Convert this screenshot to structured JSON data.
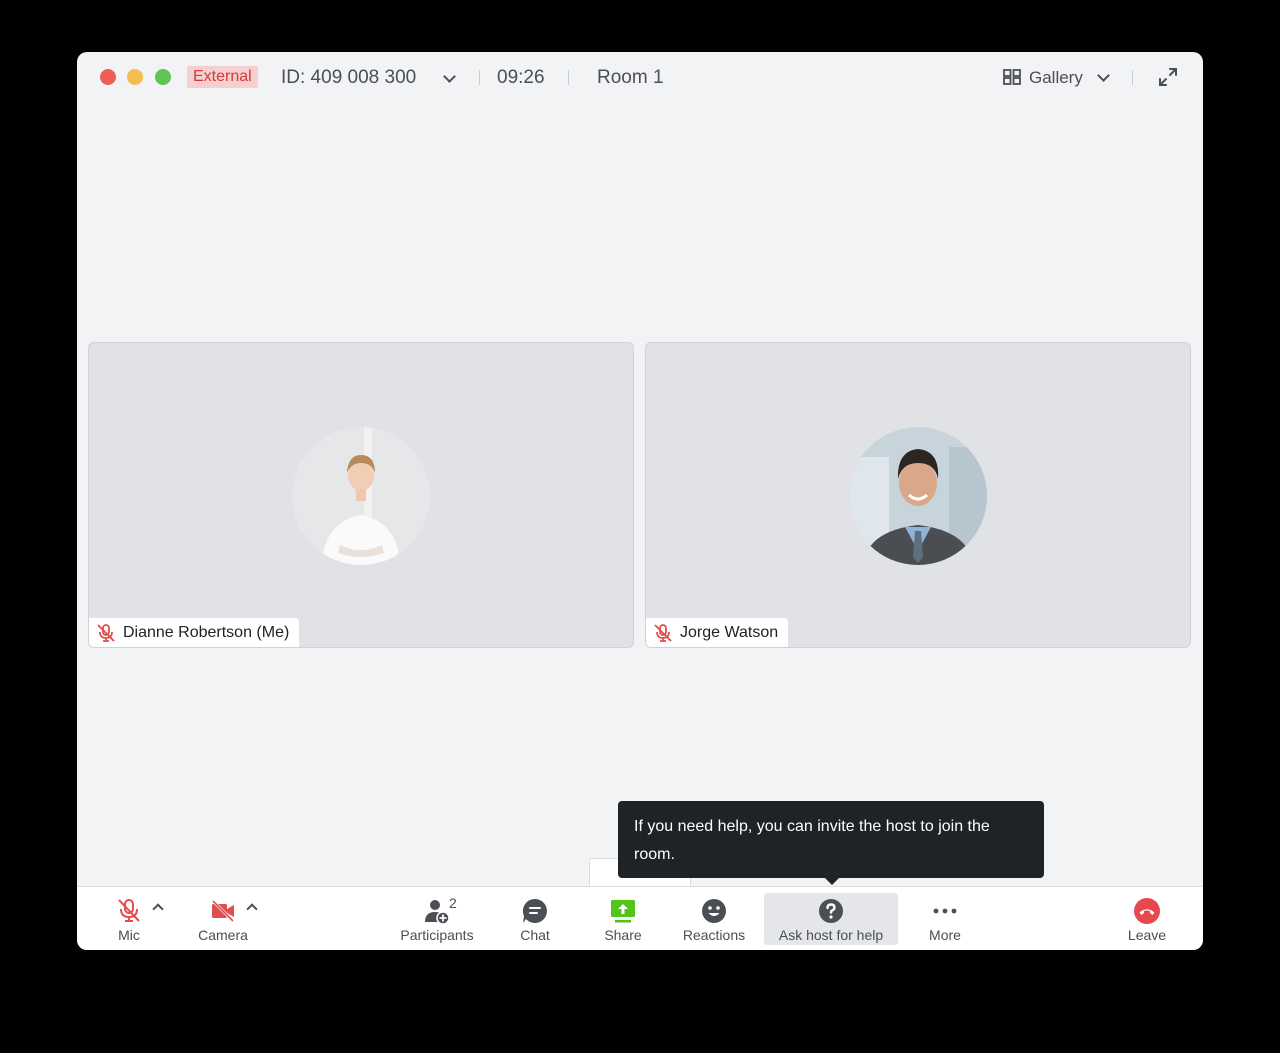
{
  "titlebar": {
    "badge": "External",
    "meeting_id": "ID: 409 008 300",
    "timer": "09:26",
    "room": "Room 1",
    "view_label": "Gallery"
  },
  "participants": [
    {
      "name": "Dianne Robertson (Me)",
      "mic": "muted"
    },
    {
      "name": "Jorge Watson",
      "mic": "muted"
    }
  ],
  "tooltip": {
    "text": "If you need help, you can invite the host to join the room."
  },
  "toolbar": {
    "mic_label": "Mic",
    "camera_label": "Camera",
    "participants_label": "Participants",
    "participants_count": "2",
    "chat_label": "Chat",
    "share_label": "Share",
    "reactions_label": "Reactions",
    "ask_host_label": "Ask host for help",
    "more_label": "More",
    "leave_label": "Leave"
  },
  "colors": {
    "muted_red": "#e24d4d",
    "share_green": "#52c41a",
    "leave_red": "#e5484d",
    "badge_bg": "#f6cfd0",
    "badge_text": "#d63a3a",
    "tooltip_bg": "#1f2227"
  },
  "icons": [
    "mic-off-icon",
    "camera-off-icon",
    "participants-icon",
    "chat-icon",
    "share-icon",
    "reactions-icon",
    "help-icon",
    "more-icon",
    "leave-icon",
    "gallery-icon",
    "expand-icon",
    "chevron-down-icon"
  ]
}
